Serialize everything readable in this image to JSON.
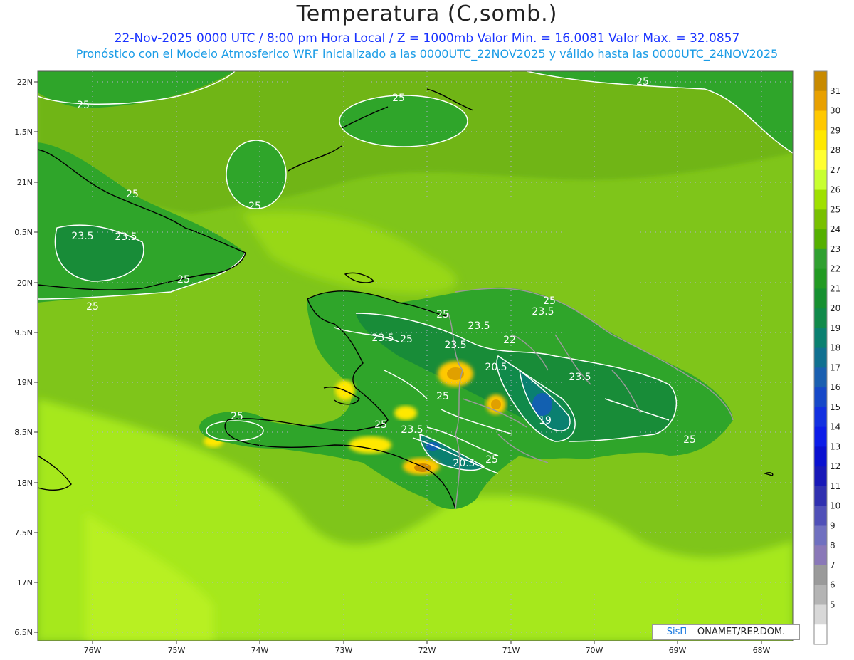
{
  "header": {
    "title": "Temperatura (C,somb.)",
    "subtitle1": "22-Nov-2025 0000 UTC / 8:00 pm Hora Local / Z = 1000mb   Valor Min. = 16.0081  Valor Max. = 32.0857",
    "subtitle2": "Pronóstico con el Modelo Atmosferico WRF inicializado a las 0000UTC_22NOV2025 y válido hasta las  0000UTC_24NOV2025"
  },
  "axes": {
    "lat_labels": [
      "22N",
      "1.5N",
      "21N",
      "0.5N",
      "20N",
      "9.5N",
      "19N",
      "8.5N",
      "18N",
      "7.5N",
      "17N",
      "6.5N"
    ],
    "lon_labels": [
      "76W",
      "75W",
      "74W",
      "73W",
      "72W",
      "71W",
      "70W",
      "69W",
      "68W"
    ]
  },
  "contour_labels": [
    "25",
    "25",
    "25",
    "25",
    "23.5",
    "23.5",
    "25",
    "25",
    "25",
    "25",
    "25",
    "23.5",
    "23.5",
    "23.5",
    "25",
    "23.5",
    "22",
    "20.5",
    "23.5",
    "25",
    "19",
    "25",
    "23.5",
    "25",
    "20.5",
    "25",
    "25"
  ],
  "colorbar": {
    "ticks": [
      "31",
      "30",
      "29",
      "28",
      "27",
      "26",
      "25",
      "24",
      "23",
      "22",
      "21",
      "20",
      "19",
      "18",
      "17",
      "16",
      "15",
      "14",
      "13",
      "12",
      "11",
      "10",
      "9",
      "8",
      "7",
      "6",
      "5"
    ],
    "colors": [
      "#c88a00",
      "#e8a000",
      "#ffc800",
      "#ffe800",
      "#ffff30",
      "#c8ff30",
      "#9fe000",
      "#78c000",
      "#55b000",
      "#30a030",
      "#229a22",
      "#169030",
      "#108a4a",
      "#0a8070",
      "#107090",
      "#1a5fb0",
      "#1648c8",
      "#1230e0",
      "#0c1ce8",
      "#0a10d0",
      "#1818b8",
      "#3030b0",
      "#5050b8",
      "#7070c0",
      "#8a78b8",
      "#9a9a9a",
      "#b4b4b4",
      "#d8d8d8",
      "#ffffff"
    ]
  },
  "colors": {
    "ocean_base": "#7fc51a",
    "ocean_light": "#a6e81e",
    "ocean_dark": "#6fb514",
    "land_green": "#2fa52a",
    "land_dark": "#188c38",
    "valley_blue": "#1260b0",
    "hot_orange": "#e0a000"
  },
  "credit": {
    "brand": "SisΠ",
    "text": " – ONAMET/REP.DOM."
  }
}
